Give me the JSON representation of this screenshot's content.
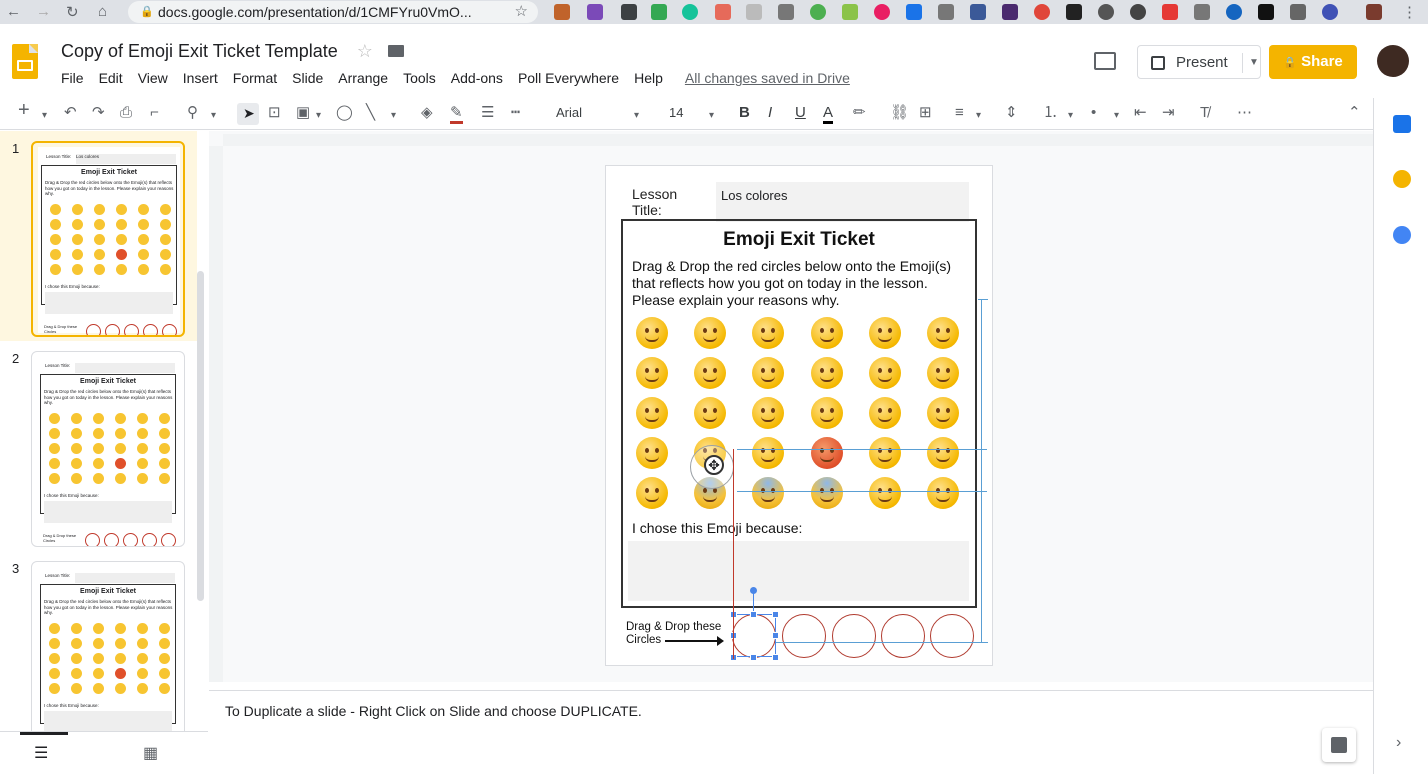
{
  "browser": {
    "url": "docs.google.com/presentation/d/1CMFYru0VmO...",
    "back_icon": "←",
    "forward_icon": "→",
    "reload_icon": "↻",
    "home_icon": "⌂",
    "star_icon": "☆",
    "lock_icon": "🔒"
  },
  "app": {
    "title": "Copy of Emoji Exit Ticket Template",
    "star_icon": "☆",
    "menus": [
      "File",
      "Edit",
      "View",
      "Insert",
      "Format",
      "Slide",
      "Arrange",
      "Tools",
      "Add-ons",
      "Poll Everywhere",
      "Help"
    ],
    "saved_status": "All changes saved in Drive",
    "present_label": "Present",
    "share_label": "Share",
    "share_icon": "🔒"
  },
  "toolbar": {
    "font": "Arial",
    "font_size": "14",
    "bold": "B",
    "italic": "I",
    "underline": "U",
    "text_color": "A",
    "more": "⋯",
    "plus": "+",
    "caret": "▾"
  },
  "filmstrip": {
    "slides": [
      {
        "num": "1",
        "lesson": "Lesson Title:",
        "value": "Los colores"
      },
      {
        "num": "2",
        "lesson": "Lesson Title:",
        "value": ""
      },
      {
        "num": "3",
        "lesson": "Lesson Title:",
        "value": ""
      }
    ],
    "thumb_title": "Emoji Exit Ticket",
    "thumb_desc": "Drag & Drop the red circles below onto the Emoji(s) that reflects how you got on today in the lesson. Please explain your reasons why.",
    "thumb_chose": "I chose this Emoji because:",
    "thumb_dd": "Drag & Drop these Circles"
  },
  "slide": {
    "lesson_label": "Lesson Title:",
    "lesson_value": "Los colores",
    "title": "Emoji Exit Ticket",
    "description": "Drag & Drop the red circles below onto the Emoji(s) that reflects how you got on today in the lesson. Please explain your reasons why.",
    "chose_label": "I chose this Emoji because:",
    "dd_label": "Drag & Drop these Circles"
  },
  "notes": {
    "text": "To Duplicate a slide - Right Click on Slide and choose DUPLICATE."
  },
  "colors": {
    "accent": "#f4b400",
    "circle": "#b03a2e",
    "guide": "#5a9fd4"
  }
}
